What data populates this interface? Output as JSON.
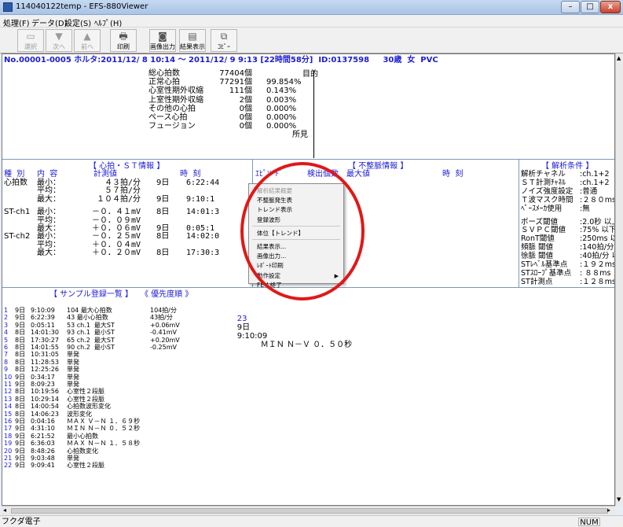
{
  "window": {
    "title": "114040122temp - EFS-880Viewer",
    "min": "–",
    "max": "□",
    "close": "x"
  },
  "menu": [
    "処理(F)",
    "データ(D)",
    "設定(S)",
    "ﾍﾙﾌﾟ(H)"
  ],
  "toolbar": [
    {
      "label": "選択",
      "icon": "select-icon",
      "disabled": true
    },
    {
      "label": "次へ",
      "icon": "arrow-down-icon",
      "disabled": true
    },
    {
      "label": "前へ",
      "icon": "arrow-up-icon",
      "disabled": true
    },
    {
      "label": "印刷",
      "icon": "printer-icon",
      "disabled": false
    },
    {
      "label": "画像出力",
      "icon": "camera-icon",
      "disabled": false
    },
    {
      "label": "結果表示",
      "icon": "display-icon",
      "disabled": false
    },
    {
      "label": "ｺﾋﾟｰ",
      "icon": "copy-icon",
      "disabled": false
    }
  ],
  "header": {
    "line": "No.00001-0005 ホルタ:2011/12/ 8 10:14 ～ 2011/12/ 9 9:13 [22時間58分]  ID:0137598     30歳  女  PVC"
  },
  "summary": {
    "rows": [
      {
        "label": "総心拍数",
        "count": "77404個",
        "pct": ""
      },
      {
        "label": "正常心拍",
        "count": "77291個",
        "pct": "99.854%"
      },
      {
        "label": "心室性期外収縮",
        "count": "111個",
        "pct": "0.143%"
      },
      {
        "label": "上室性期外収縮",
        "count": "2個",
        "pct": "0.003%"
      },
      {
        "label": "その他の心拍",
        "count": "0個",
        "pct": "0.000%"
      },
      {
        "label": "ペース心拍",
        "count": "0個",
        "pct": "0.000%"
      },
      {
        "label": "フュージョン",
        "count": "0個",
        "pct": "0.000%"
      }
    ],
    "purpose_label": "目的",
    "findings_label": "所見"
  },
  "heart_st": {
    "title": "【 心拍・ＳＴ情報 】",
    "head_kind": "種  別",
    "head_content": "内  容",
    "head_value": "計測値",
    "head_time": "時  刻",
    "rows": [
      {
        "kind": "心拍数",
        "item": "最小：",
        "value": "４３拍/分",
        "day": "9日",
        "time": "6:22:44"
      },
      {
        "kind": "",
        "item": "平均：",
        "value": "５７拍/分",
        "day": "",
        "time": ""
      },
      {
        "kind": "",
        "item": "最大：",
        "value": "１０４拍/分",
        "day": "9日",
        "time": "9:10:1"
      },
      {
        "kind": "ST-ch1",
        "item": "最小：",
        "value": "－０．４１mV",
        "day": "8日",
        "time": "14:01:3"
      },
      {
        "kind": "",
        "item": "平均：",
        "value": "－０．０９mV",
        "day": "",
        "time": ""
      },
      {
        "kind": "",
        "item": "最大：",
        "value": "＋０．０６mV",
        "day": "9日",
        "time": "0:05:1"
      },
      {
        "kind": "ST-ch2",
        "item": "最小：",
        "value": "－０．２５mV",
        "day": "8日",
        "time": "14:02:0"
      },
      {
        "kind": "",
        "item": "平均：",
        "value": "＋０．０４mV",
        "day": "",
        "time": ""
      },
      {
        "kind": "",
        "item": "最大：",
        "value": "＋０．２０mV",
        "day": "8日",
        "time": "17:30:3"
      }
    ]
  },
  "arrhythmia": {
    "title": "【 不整脈情報 】",
    "head_episode": "ｴﾋﾟｿｰﾄﾞ",
    "head_count": "検出個数",
    "head_max": "最大値",
    "head_time": "時  刻"
  },
  "analysis": {
    "title": "【 解析条件 】",
    "rows": [
      {
        "label": "解析チャネル",
        "value": ":ch.1+2"
      },
      {
        "label": "ＳＴ計測ﾁｬﾈﾙ",
        "value": ":ch.1+2"
      },
      {
        "label": "ノイズ強度設定",
        "value": ":普通"
      },
      {
        "label": "Ｔ波マスク時間",
        "value": ":２８０ms"
      },
      {
        "label": "ﾍﾟｰｽﾒｰｶ使用",
        "value": ":無"
      },
      {
        "label": "ポーズ閾値",
        "value": ":2.0秒 以上"
      },
      {
        "label": "ＳＶＰＣ閾値",
        "value": ":75% 以下"
      },
      {
        "label": "RonT閾値",
        "value": ":250ms 以下"
      },
      {
        "label": "頻脈 閾値",
        "value": ":140拍/分 以"
      },
      {
        "label": "徐脈 閾値",
        "value": ":40拍/分 以"
      },
      {
        "label": "STﾚﾍﾞﾙ基準点",
        "value": ":１９２ms"
      },
      {
        "label": "STｽﾛｰﾌﾟ基準点",
        "value": ": ８８ms"
      },
      {
        "label": "ST計測点",
        "value": ":１２８ms"
      }
    ]
  },
  "samples": {
    "title": "【 サンプル登録一覧 】",
    "order_label": "《 優先度順 》",
    "rows": [
      {
        "n": "1",
        "d": "9日",
        "t": "9:10:09",
        "desc": "104 最大心拍数",
        "val": "104拍/分"
      },
      {
        "n": "2",
        "d": "9日",
        "t": "6:22:39",
        "desc": "43 最小心拍数",
        "val": "43拍/分"
      },
      {
        "n": "3",
        "d": "9日",
        "t": "0:05:11",
        "desc": "53 ch.1  最大ST",
        "val": "+0.06mV"
      },
      {
        "n": "4",
        "d": "8日",
        "t": "14:01:30",
        "desc": "93 ch.1  最小ST",
        "val": "-0.41mV"
      },
      {
        "n": "5",
        "d": "8日",
        "t": "17:30:27",
        "desc": "65 ch.2  最大ST",
        "val": "+0.20mV"
      },
      {
        "n": "6",
        "d": "8日",
        "t": "14:01:55",
        "desc": "90 ch.2  最小ST",
        "val": "-0.25mV"
      },
      {
        "n": "7",
        "d": "8日",
        "t": "10:31:05",
        "desc": "単発",
        "val": ""
      },
      {
        "n": "8",
        "d": "8日",
        "t": "11:28:53",
        "desc": "単発",
        "val": ""
      },
      {
        "n": "9",
        "d": "8日",
        "t": "12:25:26",
        "desc": "単発",
        "val": ""
      },
      {
        "n": "10",
        "d": "9日",
        "t": "0:34:17",
        "desc": "単発",
        "val": ""
      },
      {
        "n": "11",
        "d": "9日",
        "t": "8:09:23",
        "desc": "単発",
        "val": ""
      },
      {
        "n": "12",
        "d": "8日",
        "t": "10:19:56",
        "desc": "心室性２段脈",
        "val": ""
      },
      {
        "n": "13",
        "d": "8日",
        "t": "10:29:14",
        "desc": "心室性２段脈",
        "val": ""
      },
      {
        "n": "14",
        "d": "8日",
        "t": "14:00:54",
        "desc": "心拍数波形変化",
        "val": ""
      },
      {
        "n": "15",
        "d": "8日",
        "t": "14:06:23",
        "desc": "波形変化",
        "val": ""
      },
      {
        "n": "16",
        "d": "9日",
        "t": "0:04:16",
        "desc": "ＭＡＸ Ｖ－Ｎ １．６９秒",
        "val": ""
      },
      {
        "n": "17",
        "d": "9日",
        "t": "4:31:10",
        "desc": "ＭＩＮ Ｎ－Ｎ ０．５２秒",
        "val": ""
      },
      {
        "n": "18",
        "d": "9日",
        "t": "6:21:52",
        "desc": "最小心拍数",
        "val": ""
      },
      {
        "n": "19",
        "d": "9日",
        "t": "6:36:03",
        "desc": "ＭＡＸ Ｎ－Ｎ １．５８秒",
        "val": ""
      },
      {
        "n": "20",
        "d": "9日",
        "t": "8:48:26",
        "desc": "心拍数変化",
        "val": ""
      },
      {
        "n": "21",
        "d": "9日",
        "t": "9:03:48",
        "desc": "単発",
        "val": ""
      },
      {
        "n": "22",
        "d": "9日",
        "t": "9:09:41",
        "desc": "心室性２段脈",
        "val": ""
      }
    ],
    "right_entry": {
      "n": "23",
      "d": "9日",
      "t": "9:10:09",
      "desc": "ＭＩＮ Ｎ－Ｖ ０．５０秒"
    }
  },
  "context_menu": [
    {
      "label": "解析結果概要",
      "disabled": true
    },
    {
      "label": "不整脈発生表",
      "disabled": false
    },
    {
      "label": "トレンド表示",
      "disabled": false
    },
    {
      "label": "登録波形",
      "disabled": false
    },
    {
      "label": "体位【トレンド】",
      "disabled": false,
      "sep_before": true
    },
    {
      "label": "結果表示...",
      "disabled": false,
      "sep_before": true
    },
    {
      "label": "画像出力...",
      "disabled": false
    },
    {
      "label": "ﾚﾎﾟｰﾄ印刷",
      "disabled": false
    },
    {
      "label": "動作設定",
      "disabled": false,
      "submenu": true
    },
    {
      "label": "FEV 終了",
      "disabled": false
    }
  ],
  "statusbar": {
    "left": "フクダ電子",
    "num": "NUM"
  },
  "colors": {
    "accent": "#1b1bd8",
    "annotation": "#e01818"
  }
}
